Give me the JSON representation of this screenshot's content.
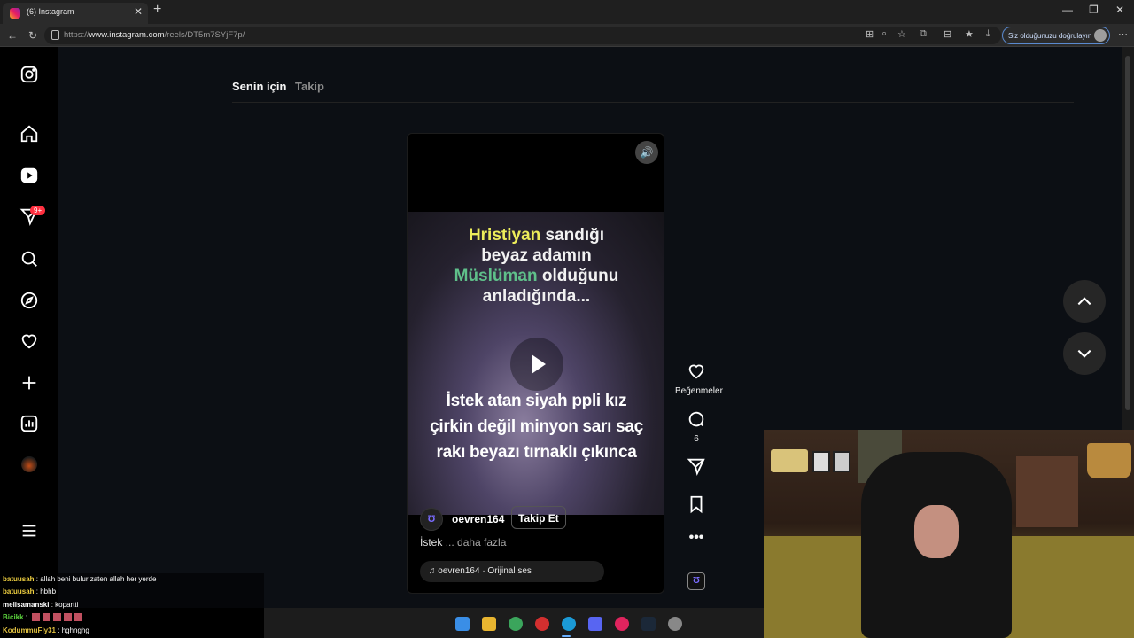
{
  "browser": {
    "tab_title": "(6) Instagram",
    "url_prefix": "https://",
    "url_host": "www.instagram.com",
    "url_path": "/reels/DT5m7SYjF7p/",
    "sign_in_label": "Siz olduğunuzu doğrulayın"
  },
  "sidebar": {
    "notifications_badge": "9+"
  },
  "feed_tabs": [
    {
      "label": "Senin için",
      "active": true
    },
    {
      "label": "Takip",
      "active": false
    }
  ],
  "reel": {
    "caption_top_parts": [
      {
        "text": "Hristiyan",
        "color": "#ecec5a"
      },
      {
        "text": " sandığı",
        "color": "#f2f2f2"
      }
    ],
    "caption_top_line2": "beyaz adamın",
    "caption_top_line3_a": "Müslüman",
    "caption_top_line3_b": " olduğunu",
    "caption_top_line4": "anladığında...",
    "caption_bottom_line1": "İstek atan siyah ppli kız",
    "caption_bottom_line2": "çirkin değil minyon sarı saç",
    "caption_bottom_line3": "rakı beyazı tırnaklı çıkınca",
    "username": "oevren164",
    "follow_label": "Takip Et",
    "description": "İstek",
    "more_label": "... daha fazla",
    "audio_label": "oevren164 · Orijinal ses"
  },
  "actions": {
    "likes_label": "Beğenmeler",
    "comments_count": "6"
  },
  "chat": [
    {
      "user": "batuusah",
      "message": "allah beni bulur zaten allah her yerde"
    },
    {
      "user": "batuusah",
      "message": "hbhb"
    },
    {
      "user": "melisamanski",
      "message": "kopartti"
    },
    {
      "user": "Bicikk",
      "message": ""
    },
    {
      "user": "KodummuFly31",
      "message": "hghnghg"
    }
  ],
  "colors": {
    "accent_badge": "#ff3040",
    "page_bg": "#0c0f14"
  }
}
